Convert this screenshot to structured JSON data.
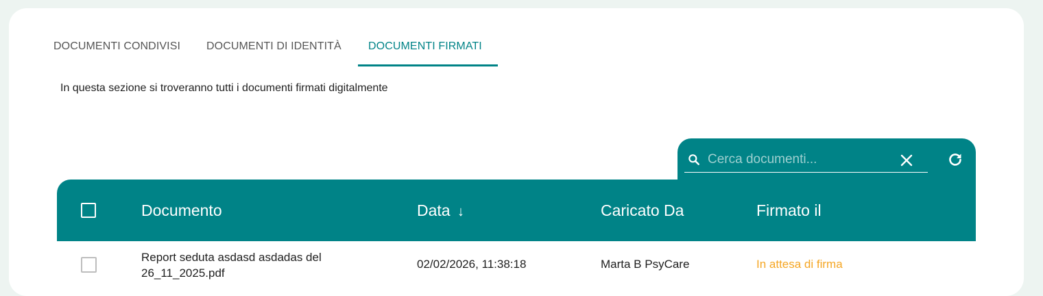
{
  "tabs": [
    {
      "label": "DOCUMENTI CONDIVISI",
      "active": false
    },
    {
      "label": "DOCUMENTI DI IDENTITÀ",
      "active": false
    },
    {
      "label": "DOCUMENTI FIRMATI",
      "active": true
    }
  ],
  "description": "In questa sezione si troveranno tutti i documenti firmati digitalmente",
  "search": {
    "placeholder": "Cerca documenti...",
    "value": "",
    "icon": "search-icon",
    "clear_icon": "close-icon",
    "refresh_icon": "refresh-icon"
  },
  "table": {
    "columns": {
      "document": "Documento",
      "date": "Data",
      "date_sort_icon": "↓",
      "uploaded_by": "Caricato Da",
      "signed_on": "Firmato il"
    },
    "rows": [
      {
        "checked": false,
        "document": "Report seduta asdasd asdadas del 26_11_2025.pdf",
        "date": "02/02/2026, 11:38:18",
        "uploaded_by": "Marta B PsyCare",
        "signed_on": "In attesa di firma"
      }
    ]
  },
  "colors": {
    "accent": "#008387",
    "pending": "#f5a623",
    "background": "#edf4f1"
  }
}
